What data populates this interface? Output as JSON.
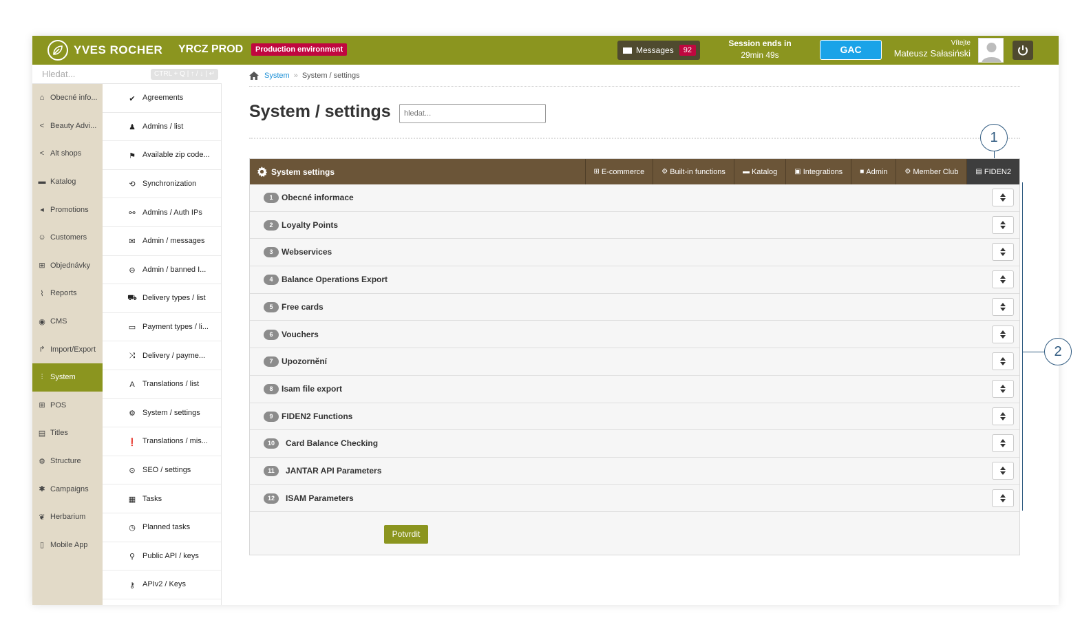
{
  "header": {
    "brand": "YVES ROCHER",
    "env_name": "YRCZ PROD",
    "env_badge": "Production environment",
    "messages_label": "Messages",
    "messages_count": "92",
    "session_label": "Session ends in",
    "session_time": "29min 49s",
    "gac_label": "GAC",
    "greeting": "Vítejte",
    "user_name": "Mateusz Sałasiński"
  },
  "search": {
    "placeholder": "Hledat...",
    "shortcut": "CTRL + Q | ↑ / ↓ | ↵"
  },
  "nav_primary": [
    {
      "label": "Obecné info...",
      "icon": "home-icon"
    },
    {
      "label": "Beauty Advi...",
      "icon": "share-icon"
    },
    {
      "label": "Alt shops",
      "icon": "share-icon"
    },
    {
      "label": "Katalog",
      "icon": "folder-icon"
    },
    {
      "label": "Promotions",
      "icon": "megaphone-icon"
    },
    {
      "label": "Customers",
      "icon": "users-icon"
    },
    {
      "label": "Objednávky",
      "icon": "cart-icon"
    },
    {
      "label": "Reports",
      "icon": "chart-icon"
    },
    {
      "label": "CMS",
      "icon": "globe-icon"
    },
    {
      "label": "Import/Export",
      "icon": "share-arrow-icon"
    },
    {
      "label": "System",
      "icon": "sliders-icon",
      "active": true
    },
    {
      "label": "POS",
      "icon": "cart-icon"
    },
    {
      "label": "Titles",
      "icon": "list-icon"
    },
    {
      "label": "Structure",
      "icon": "cog-icon"
    },
    {
      "label": "Campaigns",
      "icon": "asterisk-icon"
    },
    {
      "label": "Herbarium",
      "icon": "leaf-icon"
    },
    {
      "label": "Mobile App",
      "icon": "mobile-icon"
    }
  ],
  "nav_secondary": [
    {
      "label": "Agreements",
      "icon": "check-icon"
    },
    {
      "label": "Admins / list",
      "icon": "user-tie-icon"
    },
    {
      "label": "Available zip code...",
      "icon": "flag-icon"
    },
    {
      "label": "Synchronization",
      "icon": "refresh-icon"
    },
    {
      "label": "Admins / Auth IPs",
      "icon": "link-icon"
    },
    {
      "label": "Admin / messages",
      "icon": "envelope-icon"
    },
    {
      "label": "Admin / banned I...",
      "icon": "minus-circle-icon"
    },
    {
      "label": "Delivery types / list",
      "icon": "truck-icon"
    },
    {
      "label": "Payment types / li...",
      "icon": "money-icon"
    },
    {
      "label": "Delivery / payme...",
      "icon": "shuffle-icon"
    },
    {
      "label": "Translations / list",
      "icon": "font-icon"
    },
    {
      "label": "System / settings",
      "icon": "gear-icon"
    },
    {
      "label": "Translations / mis...",
      "icon": "exclamation-icon"
    },
    {
      "label": "SEO / settings",
      "icon": "compass-icon"
    },
    {
      "label": "Tasks",
      "icon": "clipboard-icon"
    },
    {
      "label": "Planned tasks",
      "icon": "clock-icon"
    },
    {
      "label": "Public API / keys",
      "icon": "key-search-icon"
    },
    {
      "label": "APIv2 / Keys",
      "icon": "key-icon"
    }
  ],
  "breadcrumb": {
    "link": "System",
    "sep": "»",
    "current": "System / settings"
  },
  "page": {
    "title": "System / settings",
    "search_placeholder": "hledat..."
  },
  "panel": {
    "title": "System settings",
    "tabs": [
      {
        "label": "E-commerce",
        "icon": "cart-icon"
      },
      {
        "label": "Built-in functions",
        "icon": "gear-icon"
      },
      {
        "label": "Katalog",
        "icon": "folder-icon"
      },
      {
        "label": "Integrations",
        "icon": "briefcase-icon"
      },
      {
        "label": "Admin",
        "icon": "lock-icon"
      },
      {
        "label": "Member Club",
        "icon": "cog-icon"
      },
      {
        "label": "FIDEN2",
        "icon": "card-icon",
        "active": true
      }
    ],
    "rows": [
      {
        "num": "1",
        "name": "Obecné informace"
      },
      {
        "num": "2",
        "name": "Loyalty Points"
      },
      {
        "num": "3",
        "name": "Webservices"
      },
      {
        "num": "4",
        "name": "Balance Operations Export"
      },
      {
        "num": "5",
        "name": "Free cards"
      },
      {
        "num": "6",
        "name": "Vouchers"
      },
      {
        "num": "7",
        "name": "Upozornění"
      },
      {
        "num": "8",
        "name": "Isam file export"
      },
      {
        "num": "9",
        "name": "FIDEN2 Functions"
      },
      {
        "num": "10",
        "name": "Card Balance Checking"
      },
      {
        "num": "11",
        "name": "JANTAR API Parameters"
      },
      {
        "num": "12",
        "name": "ISAM Parameters"
      }
    ],
    "confirm_label": "Potvrdit"
  },
  "annotations": {
    "callout_1": "1",
    "callout_2": "2"
  },
  "colors": {
    "brand_green": "#8b951f",
    "panel_brown": "#6b5538",
    "badge_red": "#c0073f",
    "gac_blue": "#1aa3e8",
    "nav_beige": "#e2dac8"
  }
}
